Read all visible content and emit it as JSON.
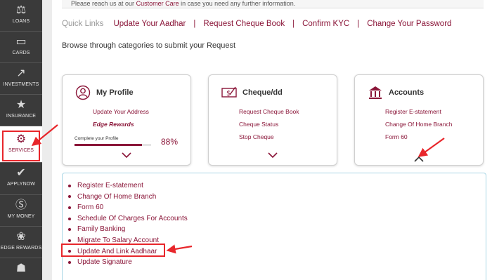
{
  "notice": {
    "prefix": "Please reach us at our",
    "link": "Customer Care",
    "suffix": "in case you need any further information."
  },
  "sidebar": {
    "items": [
      {
        "label": "LOANS",
        "icon": "loan-bag-icon"
      },
      {
        "label": "CARDS",
        "icon": "card-icon"
      },
      {
        "label": "INVESTMENTS",
        "icon": "investments-chart-icon"
      },
      {
        "label": "INSURANCE",
        "icon": "shield-icon"
      },
      {
        "label": "SERVICES",
        "icon": "services-gear-icon",
        "active": true
      },
      {
        "label": "APPLYNOW",
        "icon": "check-circle-icon"
      },
      {
        "label": "MY MONEY",
        "icon": "money-icon"
      },
      {
        "label": "EDGE REWARDS",
        "icon": "gift-icon"
      },
      {
        "label": "",
        "icon": "cart-icon"
      }
    ]
  },
  "quick_links": {
    "title": "Quick Links",
    "links": [
      "Update Your Aadhar",
      "Request Cheque Book",
      "Confirm KYC",
      "Change Your Password"
    ]
  },
  "browse_text": "Browse through categories to submit your Request",
  "cards": {
    "profile": {
      "title": "My Profile",
      "links": [
        "Update Your Address",
        "Edge Rewards"
      ],
      "progress_label": "Complete your Profile",
      "progress_pct": "88%",
      "progress_value": 0.88
    },
    "cheque": {
      "title": "Cheque/dd",
      "links": [
        "Request Cheque Book",
        "Cheque Status",
        "Stop Cheque"
      ]
    },
    "accounts": {
      "title": "Accounts",
      "links": [
        "Register E-statement",
        "Change Of Home Branch",
        "Form 60"
      ]
    }
  },
  "accounts_menu": {
    "items": [
      "Register E-statement",
      "Change Of Home Branch",
      "Form 60",
      "Schedule Of Charges For Accounts",
      "Family Banking",
      "Migrate To Salary Account",
      "Update And Link Aadhaar",
      "Update Signature"
    ]
  },
  "colors": {
    "brand": "#8a1538",
    "sidebar_bg": "#3a3a3a",
    "annotation_red": "#e8262b",
    "panel_border": "#a9d6e5"
  }
}
